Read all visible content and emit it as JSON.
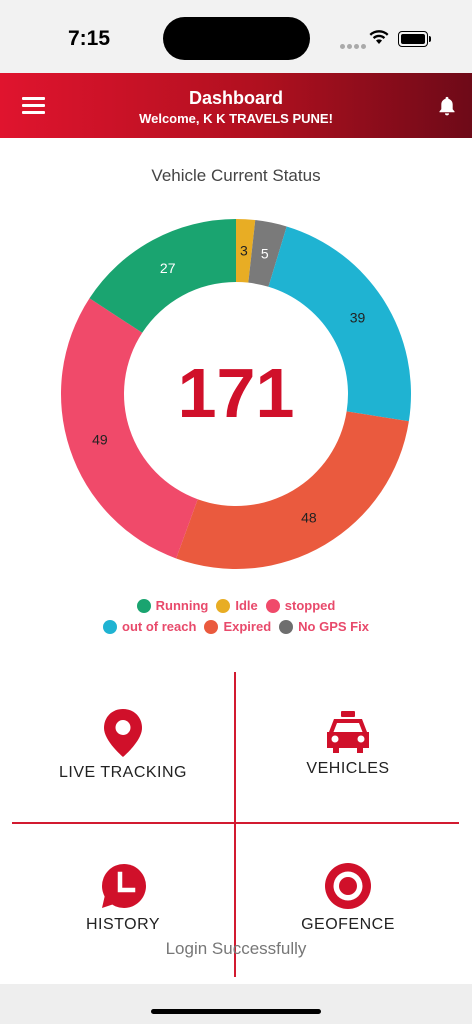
{
  "status_bar": {
    "time": "7:15"
  },
  "header": {
    "title": "Dashboard",
    "subtitle": "Welcome, K K TRAVELS PUNE!",
    "menu_icon": "hamburger-menu-icon",
    "bell_icon": "bell-icon"
  },
  "chart_title": "Vehicle Current Status",
  "chart_data": {
    "type": "pie",
    "total": "171",
    "segments": [
      {
        "name": "Idle",
        "value": 3,
        "color": "#e8ad24"
      },
      {
        "name": "No GPS Fix",
        "value": 5,
        "color": "#7a7a7a"
      },
      {
        "name": "out of reach",
        "value": 39,
        "color": "#1fb3d2"
      },
      {
        "name": "Expired",
        "value": 48,
        "color": "#ea5a3e"
      },
      {
        "name": "stopped",
        "value": 49,
        "color": "#f04a6a"
      },
      {
        "name": "Running",
        "value": 27,
        "color": "#1aa470"
      }
    ]
  },
  "legend": {
    "row1": [
      {
        "label": "Running",
        "color": "#1aa470"
      },
      {
        "label": "Idle",
        "color": "#e8ad24"
      },
      {
        "label": "stopped",
        "color": "#f04a6a"
      }
    ],
    "row2": [
      {
        "label": "out of reach",
        "color": "#1fb3d2"
      },
      {
        "label": "Expired",
        "color": "#ea5a3e"
      },
      {
        "label": "No GPS Fix",
        "color": "#6e6e6e"
      }
    ]
  },
  "tiles": {
    "live_tracking": "LIVE TRACKING",
    "vehicles": "VEHICLES",
    "history": "HISTORY",
    "geofence": "GEOFENCE"
  },
  "toast": "Login Successfully",
  "accent_color": "#d0102a"
}
